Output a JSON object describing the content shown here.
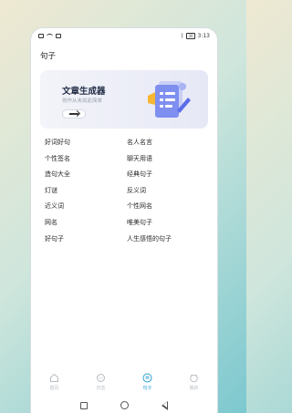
{
  "status_bar": {
    "time": "3:13",
    "battery": "30"
  },
  "page_title": "句子",
  "banner": {
    "title": "文章生成器",
    "subtitle": "创作从未如此简单"
  },
  "categories": [
    "好词好句",
    "名人名言",
    "个性签名",
    "聊天用语",
    "造句大全",
    "经典句子",
    "灯谜",
    "反义词",
    "近义词",
    "个性网名",
    "网名",
    "唯美句子",
    "好句子",
    "人生感悟的句子"
  ],
  "tabs": [
    {
      "label": "首页",
      "icon": "home-icon",
      "active": false
    },
    {
      "label": "日志",
      "icon": "chat-icon",
      "active": false
    },
    {
      "label": "句子",
      "icon": "list-icon",
      "active": true
    },
    {
      "label": "我的",
      "icon": "profile-icon",
      "active": false
    }
  ],
  "colors": {
    "accent": "#2a9fd6",
    "banner_bg": "#e9ebf7"
  }
}
